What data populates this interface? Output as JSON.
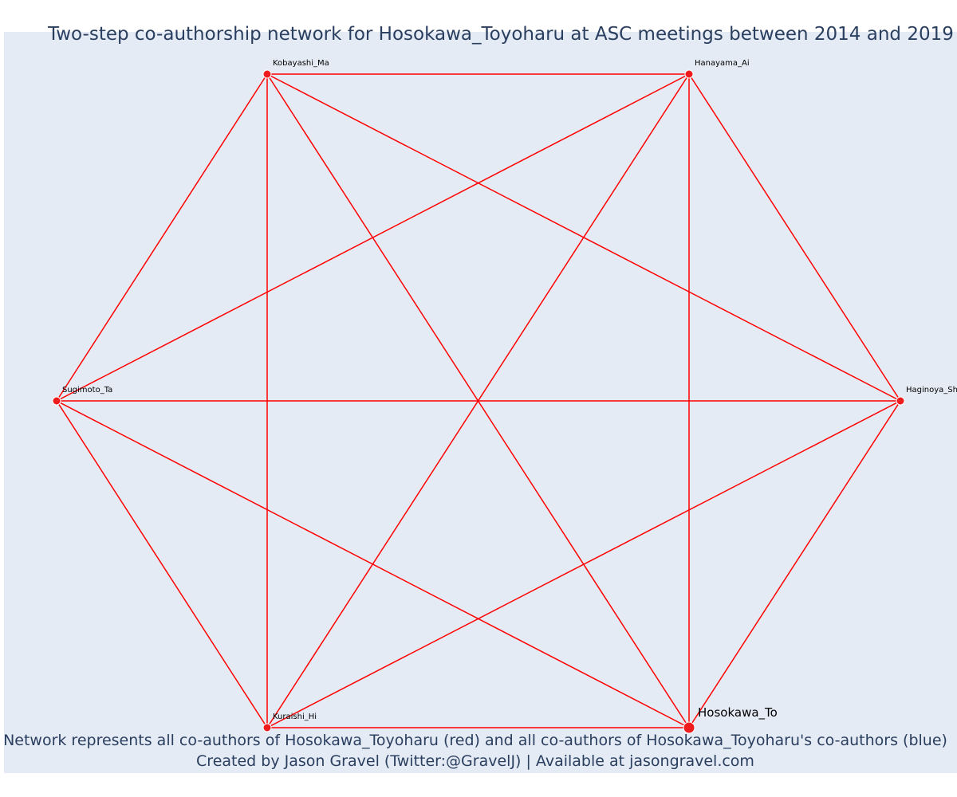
{
  "title": "Two-step co-authorship network for Hosokawa_Toyoharu at ASC meetings between 2014 and 2019",
  "footer": {
    "line1": "Network represents all co-authors of Hosokawa_Toyoharu (red) and all co-authors of Hosokawa_Toyoharu's co-authors (blue)",
    "line2": "Created by Jason Gravel (Twitter:@GravelJ) | Available at jasongravel.com"
  },
  "colors": {
    "edge": "#ff0000",
    "node": "#ee1c1c",
    "node_border": "#ffffff",
    "background": "#e5ebf5",
    "text": "#2a3f5f"
  },
  "network": {
    "focal": "Hosokawa_To",
    "nodes": [
      {
        "id": "kobayashi",
        "label": "Kobayashi_Ma",
        "type": "coauthor"
      },
      {
        "id": "hanayama",
        "label": "Hanayama_Ai",
        "type": "coauthor"
      },
      {
        "id": "sugimoto",
        "label": "Sugimoto_Ta",
        "type": "coauthor"
      },
      {
        "id": "haginoya",
        "label": "Haginoya_Sh",
        "type": "coauthor"
      },
      {
        "id": "kuraishi",
        "label": "Kuraishi_Hi",
        "type": "coauthor"
      },
      {
        "id": "hosokawa",
        "label": "Hosokawa_To",
        "type": "focal"
      }
    ],
    "edges": [
      [
        "kobayashi",
        "hanayama"
      ],
      [
        "kobayashi",
        "sugimoto"
      ],
      [
        "kobayashi",
        "haginoya"
      ],
      [
        "kobayashi",
        "kuraishi"
      ],
      [
        "kobayashi",
        "hosokawa"
      ],
      [
        "hanayama",
        "sugimoto"
      ],
      [
        "hanayama",
        "haginoya"
      ],
      [
        "hanayama",
        "kuraishi"
      ],
      [
        "hanayama",
        "hosokawa"
      ],
      [
        "sugimoto",
        "haginoya"
      ],
      [
        "sugimoto",
        "kuraishi"
      ],
      [
        "sugimoto",
        "hosokawa"
      ],
      [
        "haginoya",
        "kuraishi"
      ],
      [
        "haginoya",
        "hosokawa"
      ],
      [
        "kuraishi",
        "hosokawa"
      ]
    ]
  }
}
